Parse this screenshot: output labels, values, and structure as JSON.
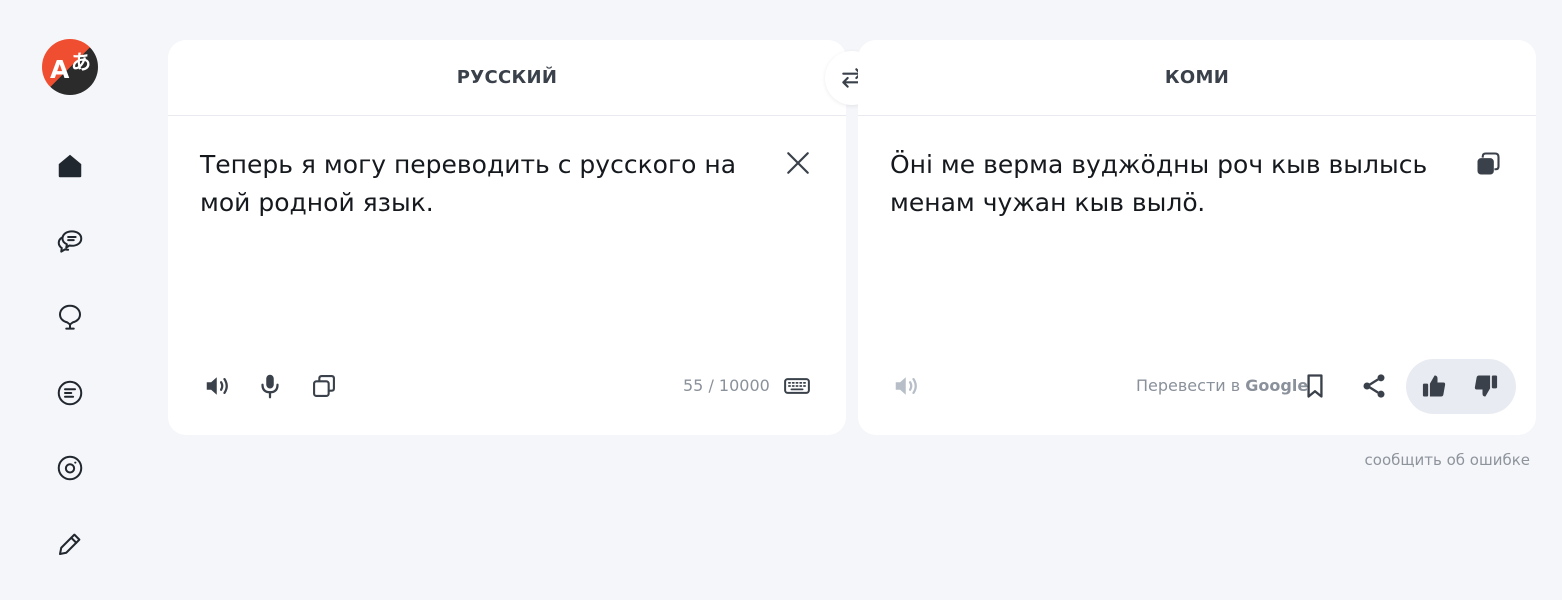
{
  "app": {
    "logo_letter_a": "A",
    "logo_letter_b": "あ"
  },
  "sidebar": {
    "items": [
      {
        "name": "home",
        "icon": "home-icon"
      },
      {
        "name": "chat",
        "icon": "chat-bubbles-icon"
      },
      {
        "name": "lightbulb",
        "icon": "lightbulb-icon"
      },
      {
        "name": "documents",
        "icon": "document-icon"
      },
      {
        "name": "camera",
        "icon": "camera-icon"
      },
      {
        "name": "edit",
        "icon": "pencil-icon"
      }
    ]
  },
  "source": {
    "language": "РУССКИЙ",
    "text": "Теперь я могу переводить с русского на мой родной язык.",
    "counter": "55 / 10000"
  },
  "target": {
    "language": "КОМИ",
    "text": "Öні ме верма вуджöдны роч кыв вылысь менам чужан кыв вылö.",
    "google_prefix": "Перевести в ",
    "google_brand": "Google"
  },
  "report_link": "сообщить об ошибке",
  "colors": {
    "accent": "#f04e30",
    "icon": "#21272e",
    "muted": "#8a919a",
    "disabled": "#b7bec8"
  }
}
